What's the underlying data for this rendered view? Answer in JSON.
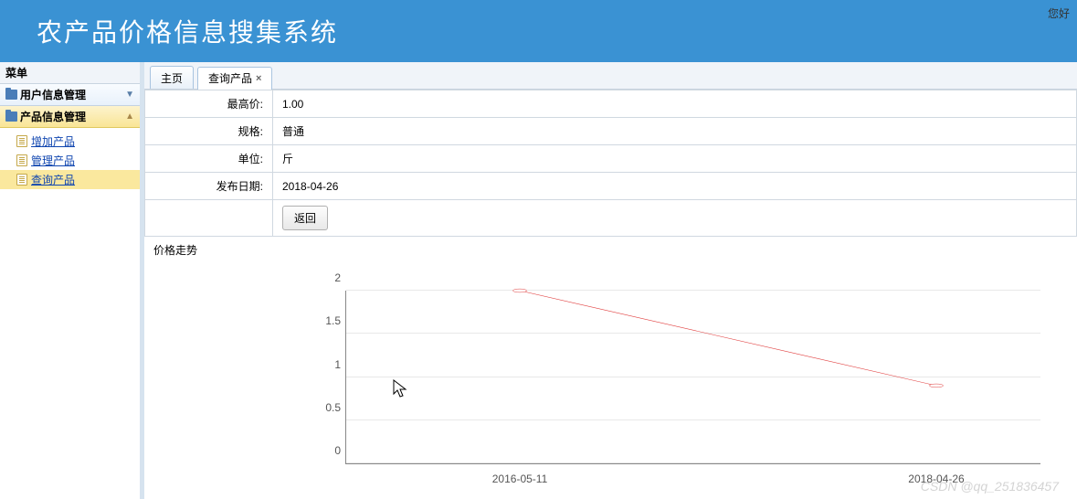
{
  "header": {
    "title": "农产品价格信息搜集系统",
    "greeting": "您好"
  },
  "sidebar": {
    "menu_label": "菜单",
    "panels": [
      {
        "title": "用户信息管理",
        "expanded": false
      },
      {
        "title": "产品信息管理",
        "expanded": true
      }
    ],
    "product_items": [
      {
        "label": "增加产品",
        "selected": false
      },
      {
        "label": "管理产品",
        "selected": false
      },
      {
        "label": "查询产品",
        "selected": true
      }
    ]
  },
  "tabs": [
    {
      "label": "主页",
      "closable": false,
      "active": false
    },
    {
      "label": "查询产品",
      "closable": true,
      "active": true
    }
  ],
  "detail": {
    "rows": [
      {
        "label": "最高价:",
        "value": "1.00"
      },
      {
        "label": "规格:",
        "value": "普通"
      },
      {
        "label": "单位:",
        "value": "斤"
      },
      {
        "label": "发布日期:",
        "value": "2018-04-26"
      }
    ],
    "back_button": "返回"
  },
  "chart_title": "价格走势",
  "chart_data": {
    "type": "line",
    "x": [
      "2016-05-11",
      "2018-04-26"
    ],
    "values": [
      2.0,
      0.9
    ],
    "ylim": [
      0,
      2
    ],
    "yticks": [
      0,
      0.5,
      1,
      1.5,
      2
    ],
    "xlabel": "",
    "ylabel": "",
    "title": ""
  },
  "watermark": "CSDN @qq_251836457"
}
